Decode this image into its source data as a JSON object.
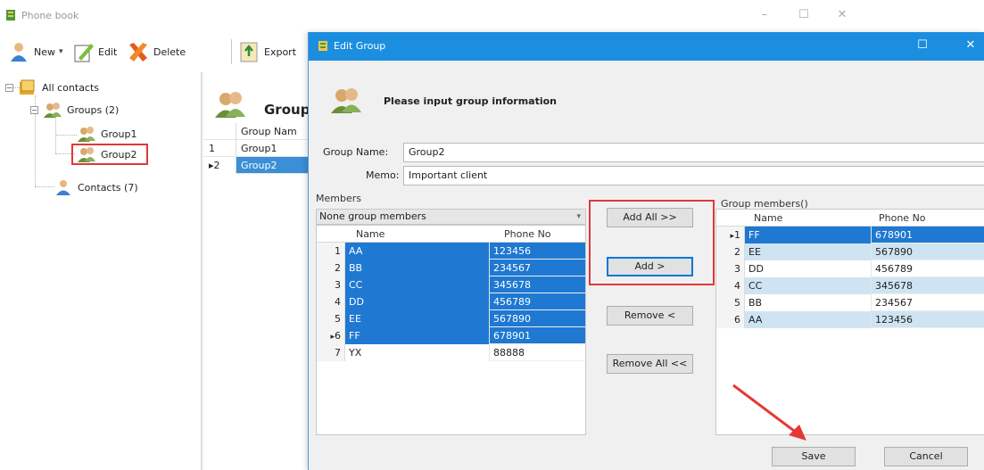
{
  "main": {
    "title": "Phone book",
    "toolbar": {
      "new": "New",
      "edit": "Edit",
      "delete": "Delete",
      "export": "Export"
    },
    "tree": {
      "root": "All contacts",
      "groups": "Groups (2)",
      "group1": "Group1",
      "group2": "Group2",
      "contacts": "Contacts (7)"
    },
    "group_panel": {
      "title": "Group",
      "col_name": "Group Nam",
      "rows": [
        {
          "index": "1",
          "name": "Group1"
        },
        {
          "index": "2",
          "name": "Group2"
        }
      ]
    }
  },
  "dialog": {
    "title": "Edit Group",
    "header": "Please input group information",
    "group_name_label": "Group Name:",
    "group_name_value": "Group2",
    "memo_label": "Memo:",
    "memo_value": "Important client",
    "members_label": "Members",
    "filter_value": "None group members",
    "left_grid": {
      "col_name": "Name",
      "col_phone": "Phone No",
      "rows": [
        {
          "index": "1",
          "name": "AA",
          "phone": "123456"
        },
        {
          "index": "2",
          "name": "BB",
          "phone": "234567"
        },
        {
          "index": "3",
          "name": "CC",
          "phone": "345678"
        },
        {
          "index": "4",
          "name": "DD",
          "phone": "456789"
        },
        {
          "index": "5",
          "name": "EE",
          "phone": "567890"
        },
        {
          "index": "6",
          "name": "FF",
          "phone": "678901"
        },
        {
          "index": "7",
          "name": "YX",
          "phone": "88888"
        }
      ]
    },
    "buttons": {
      "add_all": "Add All >>",
      "add": "Add >",
      "remove": "Remove <",
      "remove_all": "Remove All <<",
      "save": "Save",
      "cancel": "Cancel"
    },
    "group_members_label": "Group members()",
    "right_grid": {
      "col_name": "Name",
      "col_phone": "Phone No",
      "rows": [
        {
          "index": "1",
          "name": "FF",
          "phone": "678901"
        },
        {
          "index": "2",
          "name": "EE",
          "phone": "567890"
        },
        {
          "index": "3",
          "name": "DD",
          "phone": "456789"
        },
        {
          "index": "4",
          "name": "CC",
          "phone": "345678"
        },
        {
          "index": "5",
          "name": "BB",
          "phone": "234567"
        },
        {
          "index": "6",
          "name": "AA",
          "phone": "123456"
        }
      ]
    }
  },
  "colors": {
    "dialog_titlebar": "#1c8ee0",
    "selection": "#1f78d1",
    "highlight_box": "#e0383b"
  }
}
